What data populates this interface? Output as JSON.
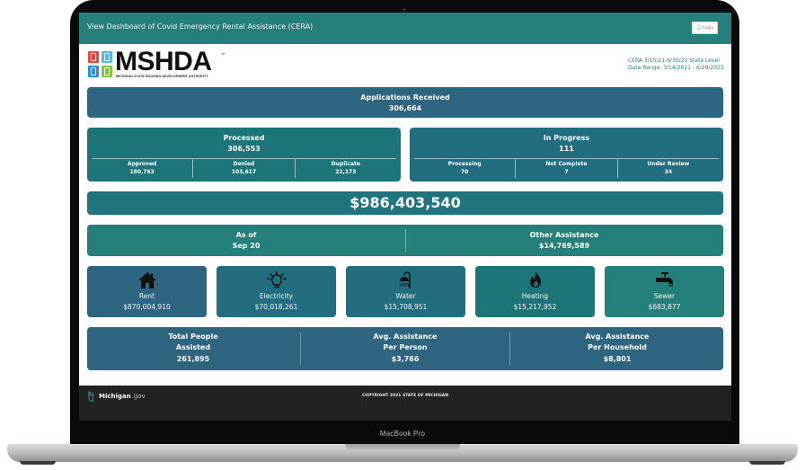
{
  "device": {
    "model_label": "MacBook Pro"
  },
  "header": {
    "title": "View Dashboard of Covid Emergency Rental Assistance (CERA)",
    "login_label": "Login",
    "login_icon": "user-icon",
    "bar_color": "#25807b"
  },
  "logo": {
    "wordmark": "MSHDA",
    "tagline": "MICHIGAN STATE HOUSING DEVELOPMENT AUTHORITY",
    "trademark": "TM",
    "tile_colors": [
      "#e8473a",
      "#5bb9dd",
      "#2f8fd0",
      "#86c440"
    ]
  },
  "meta": {
    "line1": "CERA 3/15/21-6/30/23 State Level",
    "line2": "Date Range: 3/14/2021 - 6/29/2023"
  },
  "applications": {
    "label": "Applications Received",
    "value": "306,664"
  },
  "processed": {
    "label": "Processed",
    "value": "306,553",
    "breakdown": [
      {
        "label": "Approved",
        "value": "180,763"
      },
      {
        "label": "Denied",
        "value": "103,617"
      },
      {
        "label": "Duplicate",
        "value": "22,173"
      }
    ]
  },
  "in_progress": {
    "label": "In Progress",
    "value": "111",
    "breakdown": [
      {
        "label": "Processing",
        "value": "70"
      },
      {
        "label": "Not Complete",
        "value": "7"
      },
      {
        "label": "Under Review",
        "value": "34"
      }
    ]
  },
  "total_amount": "$986,403,540",
  "as_of": {
    "label": "As of",
    "value": "Sep 20"
  },
  "other_assistance": {
    "label": "Other Assistance",
    "value": "$14,769,589"
  },
  "utilities": [
    {
      "label": "Rent",
      "value": "$870,004,910",
      "icon": "house-icon"
    },
    {
      "label": "Electricity",
      "value": "$70,018,261",
      "icon": "lightbulb-icon"
    },
    {
      "label": "Water",
      "value": "$15,708,951",
      "icon": "shower-icon"
    },
    {
      "label": "Heating",
      "value": "$15,217,952",
      "icon": "flame-icon"
    },
    {
      "label": "Sewer",
      "value": "$683,877",
      "icon": "faucet-icon"
    }
  ],
  "people": {
    "total": {
      "line1": "Total People",
      "line2": "Assisted",
      "value": "261,895"
    },
    "per_person": {
      "line1": "Avg. Assistance",
      "line2": "Per Person",
      "value": "$3,766"
    },
    "per_household": {
      "line1": "Avg. Assistance",
      "line2": "Per Household",
      "value": "$8,801"
    }
  },
  "footer": {
    "brand_word": "Michigan",
    "brand_suffix": ".gov",
    "copyright": "COPYRIGHT 2021 STATE OF MICHIGAN"
  }
}
